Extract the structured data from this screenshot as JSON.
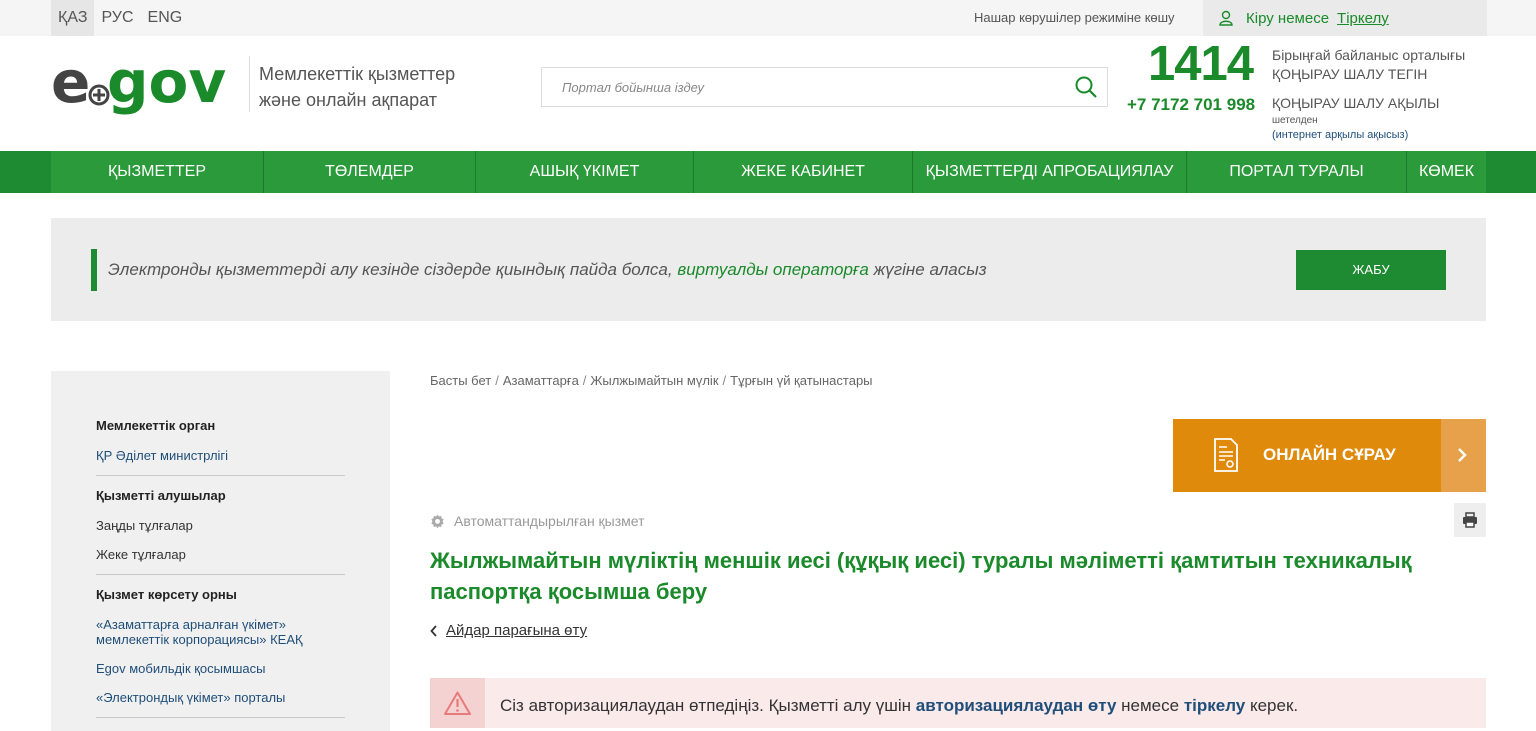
{
  "topbar": {
    "languages": [
      "ҚАЗ",
      "РУС",
      "ENG"
    ],
    "low_vision": "Нашар көрушілер режиміне көшу",
    "login": "Кіру немесе",
    "register": "Тіркелу"
  },
  "header": {
    "logo_text_e": "e",
    "logo_text_gov": "gov",
    "tagline_line1": "Мемлекеттік қызметтер",
    "tagline_line2": "және онлайн ақпарат",
    "search_placeholder": "Портал бойынша іздеу",
    "hotline_number": "1414",
    "hotline_desc_line1": "Бірыңғай байланыс орталығы",
    "hotline_desc_line2": "ҚОҢЫРАУ ШАЛУ ТЕГІН",
    "phone": "+7 7172 701 998",
    "paid_call": "ҚОҢЫРАУ ШАЛУ АҚЫЛЫ",
    "abroad": "шетелден",
    "internet_paid": "(интернет арқылы ақысыз)"
  },
  "nav": {
    "items": [
      "ҚЫЗМЕТТЕР",
      "ТӨЛЕМДЕР",
      "АШЫҚ ҮКІМЕТ",
      "ЖЕКЕ КАБИНЕТ",
      "ҚЫЗМЕТТЕРДІ АПРОБАЦИЯЛАУ",
      "ПОРТАЛ ТУРАЛЫ",
      "КӨМЕК"
    ]
  },
  "notice": {
    "text_before": "Электронды қызметтерді алу кезінде сіздерде қиындық пайда болса, ",
    "link": "виртуалды операторға",
    "text_after": " жүгіне аласыз",
    "close": "ЖАБУ"
  },
  "sidebar": {
    "gov_body_heading": "Мемлекеттік орган",
    "gov_body": "ҚР Әділет министрлігі",
    "recipients_heading": "Қызметті алушылар",
    "recipient_1": "Заңды тұлғалар",
    "recipient_2": "Жеке тұлғалар",
    "place_heading": "Қызмет көрсету орны",
    "place_1_line1": "«Азаматтарға арналған үкімет»",
    "place_1_line2": "мемлекеттік корпорациясы» КЕАҚ",
    "place_2": "Egov мобильдік қосымшасы",
    "place_3": "«Электрондық үкімет» порталы"
  },
  "main": {
    "breadcrumbs": [
      "Басты бет",
      "Азаматтарға",
      "Жылжымайтын мүлік",
      "Тұрғын үй қатынастары"
    ],
    "online_request": "ОНЛАЙН СҰРАУ",
    "automated": "Автоматтандырылған қызмет",
    "title": "Жылжымайтын мүліктің меншік иесі (құқық иесі) туралы мәліметті қамтитын техникалық паспортқа қосымша беру",
    "back": "Айдар парағына өту",
    "alert_before": "Сіз авторизациялаудан өтпедіңіз. Қызметті алу үшін ",
    "alert_link1": "авторизациялаудан өту",
    "alert_middle": " немесе ",
    "alert_link2": "тіркелу",
    "alert_after": " керек."
  },
  "colors": {
    "brand_green": "#1e8b32",
    "orange": "#e08a0b",
    "link_blue": "#1f4e79"
  }
}
